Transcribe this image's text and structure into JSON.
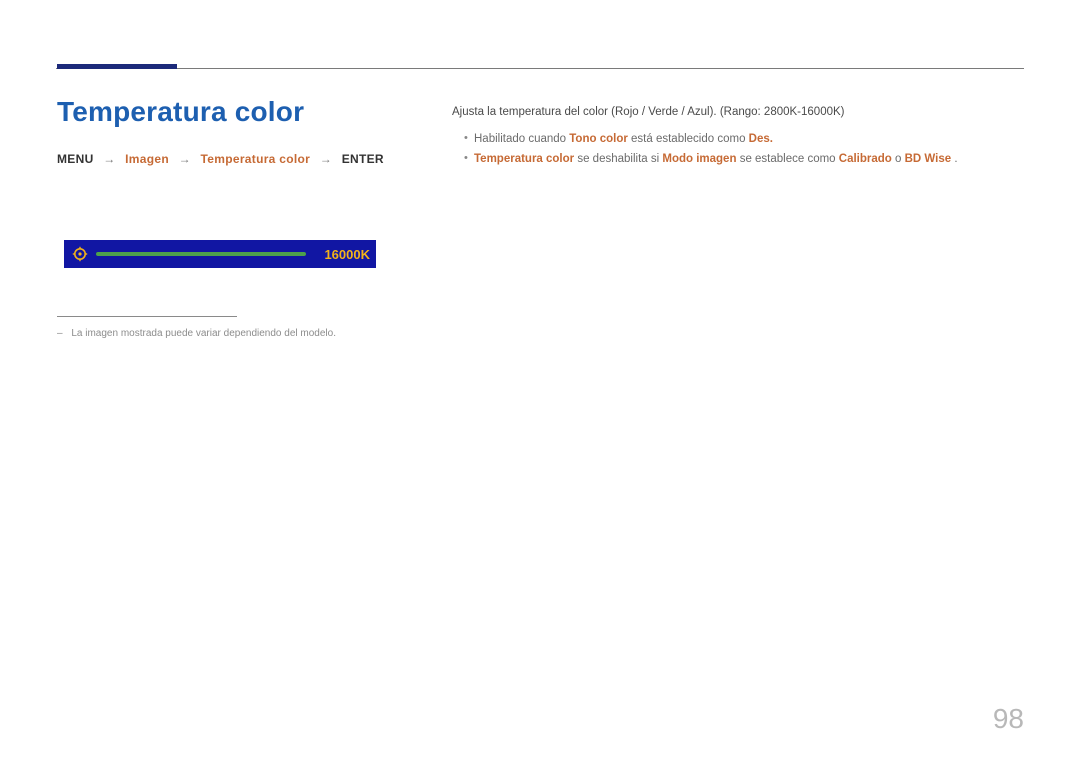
{
  "title": "Temperatura color",
  "breadcrumb": {
    "menu": "MENU",
    "item1": "Imagen",
    "item2": "Temperatura color",
    "enter": "ENTER"
  },
  "slider": {
    "value": "16000K"
  },
  "footnote": "La imagen mostrada puede variar dependiendo del modelo.",
  "right": {
    "intro": "Ajusta la temperatura del color (Rojo / Verde / Azul). (Rango: 2800K-16000K)",
    "bullets": [
      {
        "pre": "Habilitado cuando ",
        "h1": "Tono color",
        "mid1": " está establecido como ",
        "h2": "Des.",
        "mid2": "",
        "h3": "",
        "mid3": "",
        "h4": "",
        "tail": ""
      },
      {
        "pre": "",
        "h1": "Temperatura color",
        "mid1": " se deshabilita si ",
        "h2": "Modo imagen",
        "mid2": " se establece como ",
        "h3": "Calibrado",
        "mid3": " o ",
        "h4": "BD Wise",
        "tail": "."
      }
    ]
  },
  "page_number": "98"
}
